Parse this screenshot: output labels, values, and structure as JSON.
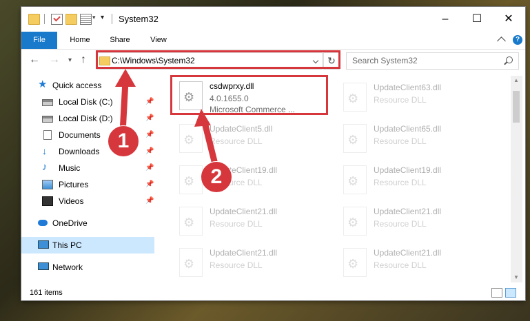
{
  "window": {
    "title": "System32",
    "minimize": "–",
    "maximize": "☐",
    "close": "✕"
  },
  "ribbon": {
    "tabs": [
      "File",
      "Home",
      "Share",
      "View"
    ],
    "help": "?"
  },
  "nav": {
    "back": "←",
    "forward": "→",
    "recent": "▾",
    "up": "↑",
    "address": "C:\\Windows\\System32",
    "refresh": "↻",
    "search_placeholder": "Search System32"
  },
  "sidebar": {
    "items": [
      {
        "label": "Quick access",
        "icon": "star-icon",
        "pinned": false
      },
      {
        "label": "Local Disk (C:)",
        "icon": "disk-icon",
        "pinned": true
      },
      {
        "label": "Local Disk (D:)",
        "icon": "disk-icon",
        "pinned": true
      },
      {
        "label": "Documents",
        "icon": "documents-icon",
        "pinned": true
      },
      {
        "label": "Downloads",
        "icon": "download-icon",
        "pinned": true
      },
      {
        "label": "Music",
        "icon": "music-icon",
        "pinned": true
      },
      {
        "label": "Pictures",
        "icon": "pictures-icon",
        "pinned": true
      },
      {
        "label": "Videos",
        "icon": "videos-icon",
        "pinned": true
      },
      {
        "label": "OneDrive",
        "icon": "cloud-icon",
        "pinned": false
      },
      {
        "label": "This PC",
        "icon": "pc-icon",
        "pinned": false,
        "selected": true
      },
      {
        "label": "Network",
        "icon": "network-icon",
        "pinned": false
      }
    ]
  },
  "files": {
    "highlighted": {
      "name": "csdwprxy.dll",
      "version": "4.0.1655.0",
      "company": "Microsoft Commerce ..."
    },
    "left_column": [
      {
        "name": "UpdateClient5.dll",
        "type": "Resource DLL"
      },
      {
        "name": "UpdateClient19.dll",
        "type": "Resource DLL"
      },
      {
        "name": "UpdateClient21.dll",
        "type": "Resource DLL"
      },
      {
        "name": "UpdateClient21.dll",
        "type": "Resource DLL"
      }
    ],
    "right_column": [
      {
        "name": "UpdateClient63.dll",
        "type": "Resource DLL"
      },
      {
        "name": "UpdateClient65.dll",
        "type": "Resource DLL"
      },
      {
        "name": "UpdateClient19.dll",
        "type": "Resource DLL"
      },
      {
        "name": "UpdateClient21.dll",
        "type": "Resource DLL"
      },
      {
        "name": "UpdateClient21.dll",
        "type": "Resource DLL"
      }
    ]
  },
  "status": {
    "item_count": "161 items"
  },
  "callouts": [
    "1",
    "2"
  ],
  "colors": {
    "accent": "#1979ca",
    "annotation_red": "#d6373c",
    "selection": "#cce8ff"
  }
}
